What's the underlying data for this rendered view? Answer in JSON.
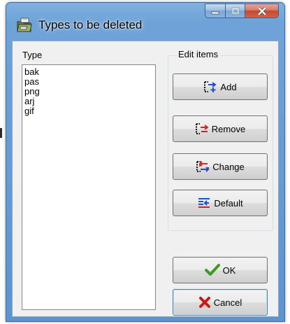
{
  "window": {
    "title": "Types to be deleted"
  },
  "type_label": "Type",
  "types": [
    "bak",
    "pas",
    "png",
    "arj",
    "gif"
  ],
  "edit_items": {
    "caption": "Edit items",
    "add_label": "Add",
    "remove_label": "Remove",
    "change_label": "Change",
    "default_label": "Default"
  },
  "ok_label": "OK",
  "cancel_label": "Cancel"
}
